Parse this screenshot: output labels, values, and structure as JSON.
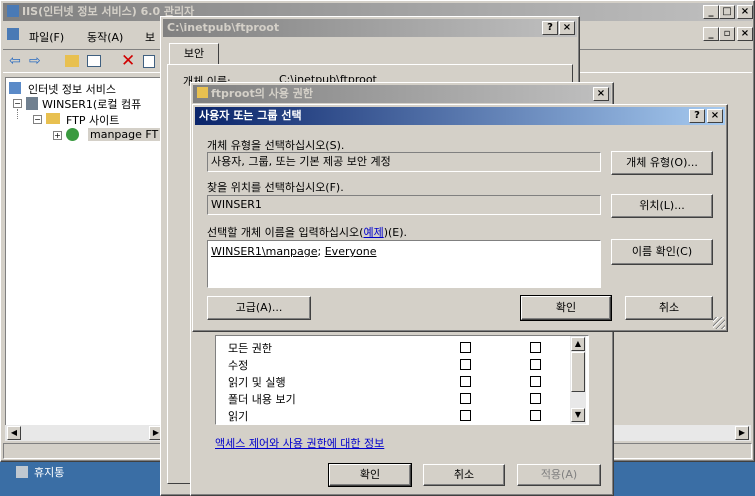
{
  "main_window": {
    "title": "IIS(인터넷 정보 서비스) 6.0 관리자",
    "menu": [
      "파일(F)",
      "동작(A)",
      "보"
    ],
    "tree": {
      "root": "인터넷 정보 서비스",
      "server": "WINSER1(로컬 컴퓨",
      "ftp_sites": "FTP 사이트",
      "site": "manpage FT"
    },
    "taskbar_item": "휴지통"
  },
  "props_window": {
    "title": "C:\\inetpub\\ftproot",
    "tab": "보안",
    "object_name_label": "개체 이름:",
    "object_name_value": "C:\\inetpub\\ftproot"
  },
  "perm_window": {
    "title": "ftproot의 사용 권한",
    "permissions": [
      "모든 권한",
      "수정",
      "읽기 및 실행",
      "폴더 내용 보기",
      "읽기"
    ],
    "info_link": "액세스 제어와 사용 권한에 대한 정보",
    "ok": "확인",
    "cancel": "취소",
    "apply": "적용(A)"
  },
  "select_dialog": {
    "title": "사용자 또는 그룹 선택",
    "object_type_label": "개체 유형을 선택하십시오(S).",
    "object_type_value": "사용자, 그룹, 또는 기본 제공 보안 계정",
    "object_type_button": "개체 유형(O)...",
    "location_label": "찾을 위치를 선택하십시오(F).",
    "location_value": "WINSER1",
    "location_button": "위치(L)...",
    "names_label_prefix": "선택할 개체 이름을 입력하십시오(",
    "names_label_link": "예제",
    "names_label_suffix": ")(E).",
    "names_entry_1": "WINSER1\\manpage",
    "names_separator": "; ",
    "names_entry_2": "Everyone",
    "check_names_button": "이름 확인(C)",
    "advanced_button": "고급(A)...",
    "ok": "확인",
    "cancel": "취소"
  }
}
